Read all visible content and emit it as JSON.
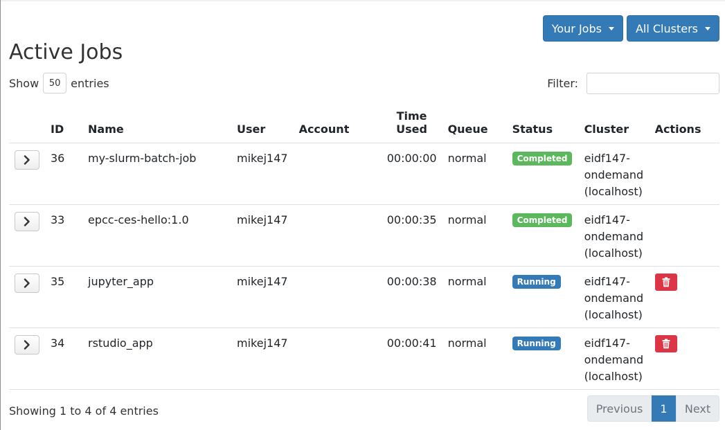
{
  "header": {
    "your_jobs_label": "Your Jobs",
    "all_clusters_label": "All Clusters",
    "title": "Active Jobs"
  },
  "controls": {
    "show_label": "Show",
    "page_length": "50",
    "entries_label": "entries",
    "filter_label": "Filter:",
    "filter_value": ""
  },
  "table": {
    "columns": {
      "id": "ID",
      "name": "Name",
      "user": "User",
      "account": "Account",
      "time_line1": "Time",
      "time_line2": "Used",
      "queue": "Queue",
      "status": "Status",
      "cluster": "Cluster",
      "actions": "Actions"
    },
    "rows": [
      {
        "id": "36",
        "name": "my-slurm-batch-job",
        "user": "mikej147",
        "account": "",
        "time": "00:00:00",
        "queue": "normal",
        "status": "Completed",
        "cluster1": "eidf147-",
        "cluster2": "ondemand",
        "cluster3": "(localhost)",
        "deletable": false
      },
      {
        "id": "33",
        "name": "epcc-ces-hello:1.0",
        "user": "mikej147",
        "account": "",
        "time": "00:00:35",
        "queue": "normal",
        "status": "Completed",
        "cluster1": "eidf147-",
        "cluster2": "ondemand",
        "cluster3": "(localhost)",
        "deletable": false
      },
      {
        "id": "35",
        "name": "jupyter_app",
        "user": "mikej147",
        "account": "",
        "time": "00:00:38",
        "queue": "normal",
        "status": "Running",
        "cluster1": "eidf147-",
        "cluster2": "ondemand",
        "cluster3": "(localhost)",
        "deletable": true
      },
      {
        "id": "34",
        "name": "rstudio_app",
        "user": "mikej147",
        "account": "",
        "time": "00:00:41",
        "queue": "normal",
        "status": "Running",
        "cluster1": "eidf147-",
        "cluster2": "ondemand",
        "cluster3": "(localhost)",
        "deletable": true
      }
    ]
  },
  "footer": {
    "info": "Showing 1 to 4 of 4 entries",
    "previous": "Previous",
    "current_page": "1",
    "next": "Next"
  },
  "colors": {
    "primary": "#337ab7",
    "completed": "#5cb85c",
    "running": "#337ab7",
    "danger": "#dc3545"
  },
  "icons": {
    "expand": "chevron-right-icon",
    "delete": "trash-icon",
    "dropdown": "caret-down-icon"
  }
}
